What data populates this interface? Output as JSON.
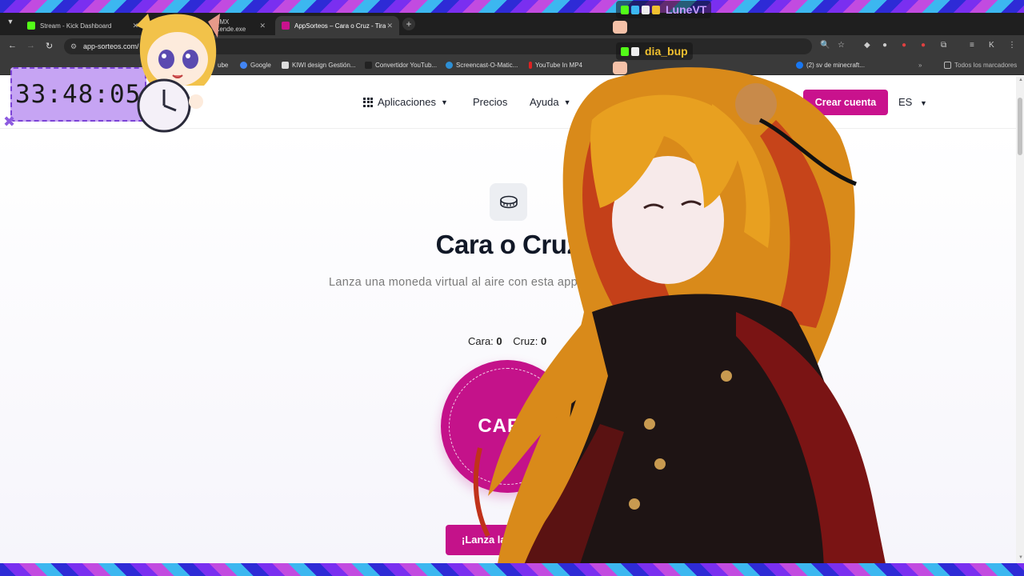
{
  "browser": {
    "tabs": [
      {
        "label": "Stream - Kick Dashboard",
        "favicon_color": "#53fc18"
      },
      {
        "label": "SMX Kende.exe",
        "favicon_color": "#888888"
      },
      {
        "label": "AppSorteos – Cara o Cruz - Tira",
        "favicon_color": "#c9128d"
      }
    ],
    "url": "app-sorteos.com/",
    "bookmarks": [
      {
        "label": "ube"
      },
      {
        "label": "Google"
      },
      {
        "label": "KIWI design Gestión..."
      },
      {
        "label": "Convertidor YouTub..."
      },
      {
        "label": "Screencast-O-Matic..."
      },
      {
        "label": "YouTube In MP4"
      },
      {
        "label": "(2) sv de minecraft..."
      },
      {
        "label": "Todos los marcadores"
      }
    ]
  },
  "site": {
    "nav": {
      "apps": "Aplicaciones",
      "pricing": "Precios",
      "help": "Ayuda",
      "signup": "Crear cuenta",
      "lang": "ES"
    },
    "title": "Cara o Cruz",
    "subtitle": "Lanza una moneda virtual al aire con esta app onli",
    "score": {
      "heads_label": "Cara:",
      "heads": "0",
      "tails_label": "Cruz:",
      "tails": "0"
    },
    "coin_face": "CARA",
    "launch_button": "¡Lanza la mo",
    "accent_color": "#c9128d"
  },
  "overlay": {
    "timer": "33:48:05",
    "chat": [
      {
        "user": "LuneVT",
        "color": "#c79bff"
      },
      {
        "user": "dia_bup",
        "color": "#f0c030"
      }
    ]
  }
}
